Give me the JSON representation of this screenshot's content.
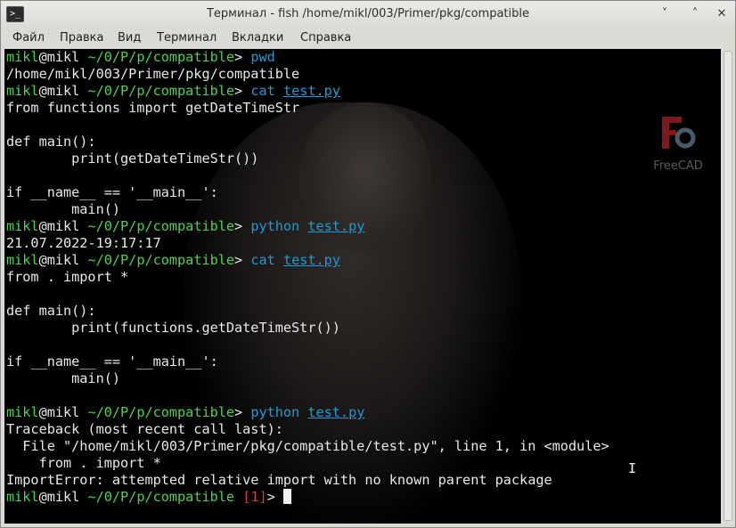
{
  "window": {
    "title": "Терминал - fish /home/mikl/003/Primer/pkg/compatible",
    "app_icon": "terminal-icon",
    "buttons": {
      "minimize": "˅",
      "maximize": "˄",
      "close": "✕"
    }
  },
  "menubar": {
    "items": [
      "Файл",
      "Правка",
      "Вид",
      "Терминал",
      "Вкладки",
      "Справка"
    ]
  },
  "desktop": {
    "freecad_label": "FreeCAD"
  },
  "prompt": {
    "user": "mikl",
    "at": "@",
    "host": "mikl",
    "path": " ~/0/P/p/compatible",
    "arrow": "> "
  },
  "terminal": {
    "pwd_cmd": "pwd",
    "pwd_out": "/home/mikl/003/Primer/pkg/compatible",
    "cat": "cat",
    "python": "python",
    "file": "test.py",
    "file1": [
      "from functions import getDateTimeStr",
      "",
      "def main():",
      "        print(getDateTimeStr())",
      "",
      "if __name__ == '__main__':",
      "        main()"
    ],
    "run1_out": "21.07.2022-19:17:17",
    "file2": [
      "from . import *",
      "",
      "def main():",
      "        print(functions.getDateTimeStr())",
      "",
      "if __name__ == '__main__':",
      "        main()",
      ""
    ],
    "traceback": [
      "Traceback (most recent call last):",
      "  File \"/home/mikl/003/Primer/pkg/compatible/test.py\", line 1, in <module>",
      "    from . import *",
      "ImportError: attempted relative import with no known parent package"
    ],
    "status_open": " [",
    "status_code": "1",
    "status_close": "]",
    "final_arrow": "> "
  },
  "colors": {
    "prompt_green": "#4bd34b",
    "command_blue": "#1e9bd6",
    "error_red": "#d63a3a",
    "terminal_bg": "#000000"
  }
}
